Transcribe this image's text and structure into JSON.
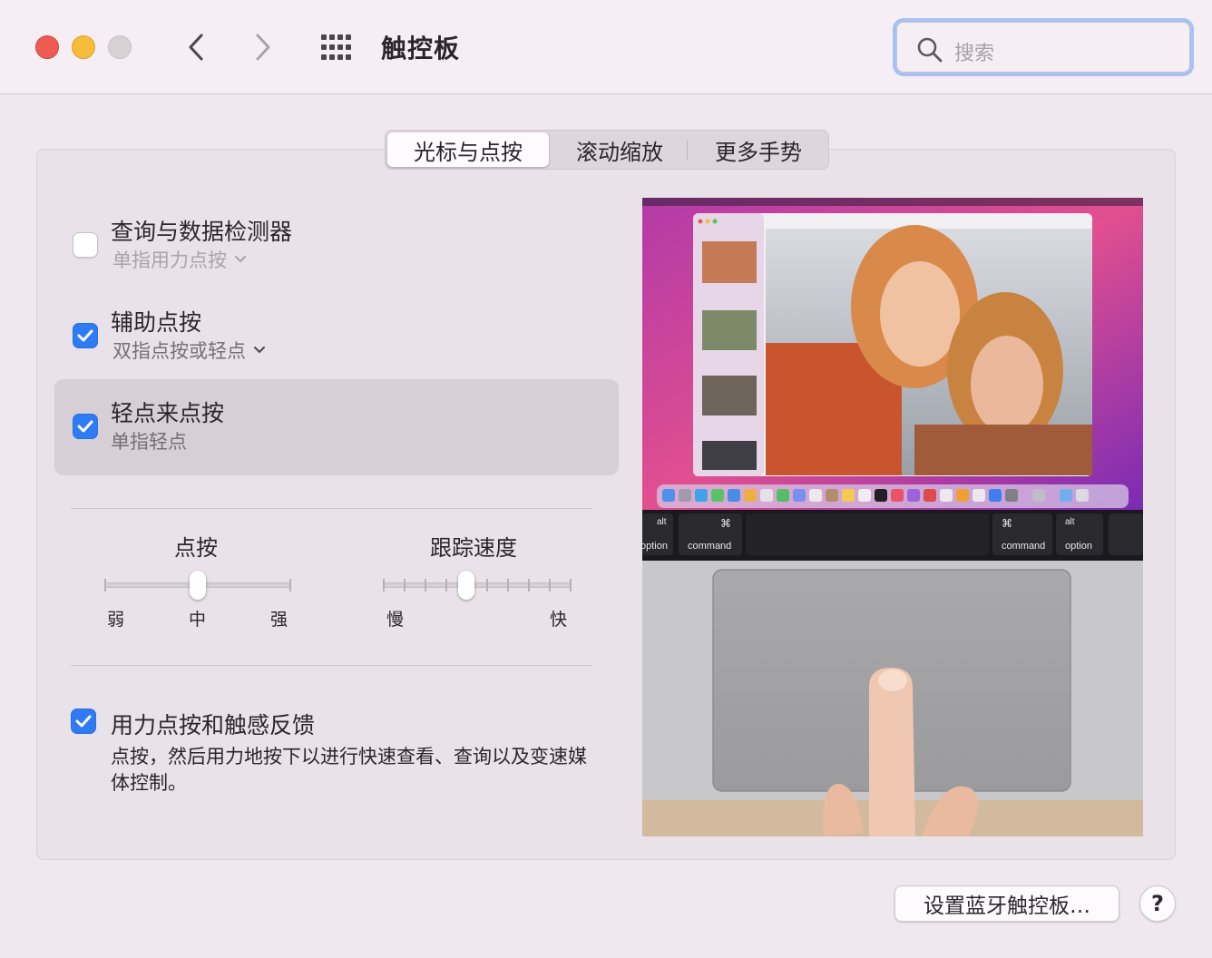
{
  "window": {
    "title": "触控板"
  },
  "search": {
    "placeholder": "搜索"
  },
  "tabs": [
    {
      "label": "光标与点按",
      "selected": true
    },
    {
      "label": "滚动缩放",
      "selected": false
    },
    {
      "label": "更多手势",
      "selected": false
    }
  ],
  "options": [
    {
      "title": "查询与数据检测器",
      "subtitle": "单指用力点按",
      "checked": false,
      "has_dropdown": true
    },
    {
      "title": "辅助点按",
      "subtitle": "双指点按或轻点",
      "checked": true,
      "has_dropdown": true
    },
    {
      "title": "轻点来点按",
      "subtitle": "单指轻点",
      "checked": true,
      "has_dropdown": false
    }
  ],
  "sliders": {
    "click": {
      "title": "点按",
      "min_label": "弱",
      "mid_label": "中",
      "max_label": "强",
      "value": 0.5
    },
    "tracking": {
      "title": "跟踪速度",
      "min_label": "慢",
      "max_label": "快",
      "value": 0.44
    }
  },
  "force_click": {
    "title": "用力点按和触感反馈",
    "description": "点按，然后用力地按下以进行快速查看、查询以及变速媒体控制。",
    "checked": true
  },
  "preview": {
    "keys": {
      "alt": "alt",
      "option": "option",
      "command": "command",
      "cmd_symbol": "⌘"
    }
  },
  "buttons": {
    "setup_bluetooth": "设置蓝牙触控板…",
    "help": "?"
  },
  "colors": {
    "accent": "#2f7bf4",
    "close": "#ee5b52",
    "minimize": "#f5bd3a"
  }
}
